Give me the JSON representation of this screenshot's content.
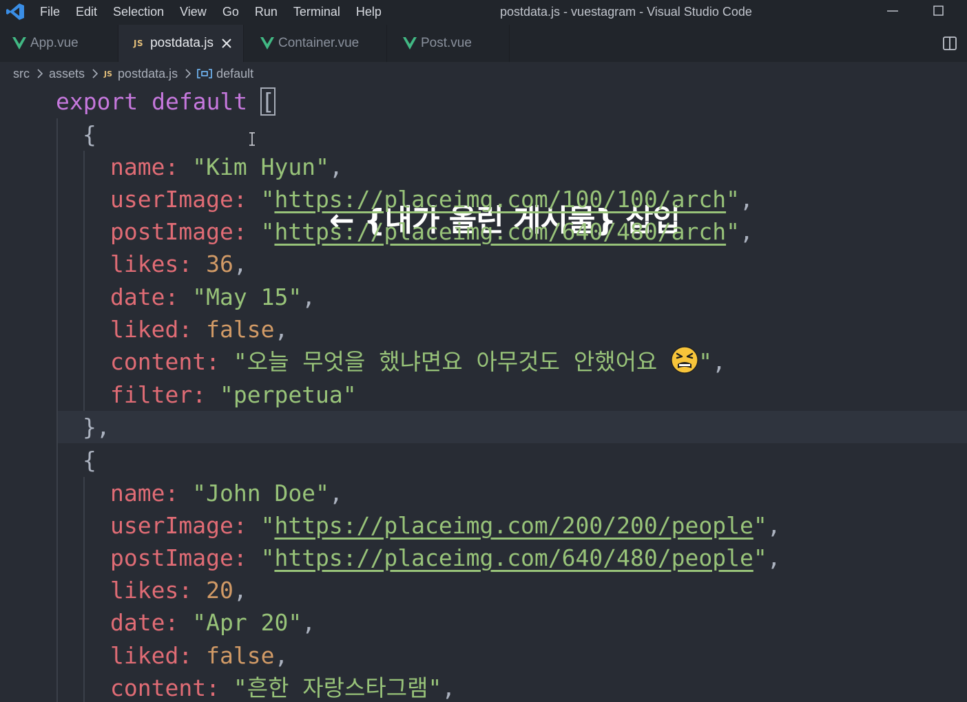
{
  "window": {
    "title": "postdata.js - vuestagram - Visual Studio Code",
    "menu": [
      "File",
      "Edit",
      "Selection",
      "View",
      "Go",
      "Run",
      "Terminal",
      "Help"
    ]
  },
  "tabs": [
    {
      "label": "App.vue",
      "icon": "vue-icon",
      "active": false
    },
    {
      "label": "postdata.js",
      "icon": "js-icon",
      "icon_text": "JS",
      "active": true
    },
    {
      "label": "Container.vue",
      "icon": "vue-icon",
      "active": false
    },
    {
      "label": "Post.vue",
      "icon": "vue-icon",
      "active": false
    }
  ],
  "breadcrumb": {
    "items": [
      "src",
      "assets",
      "postdata.js",
      "default"
    ],
    "js_icon_text": "JS"
  },
  "annotation": "← {내가 올린 게시물} 삽입",
  "code": {
    "export_kw": "export",
    "default_kw": "default",
    "open_bracket": "[",
    "posts": [
      {
        "name": "Kim Hyun",
        "userImage": "https://placeimg.com/100/100/arch",
        "postImage": "https://placeimg.com/640/480/arch",
        "likes": "36",
        "date": "May 15",
        "liked": "false",
        "content": "오늘 무엇을 했냐면요 아무것도 안했어요 ",
        "content_emoji": "tired-face-emoji",
        "filter": "perpetua"
      },
      {
        "name": "John Doe",
        "userImage": "https://placeimg.com/200/200/people",
        "postImage": "https://placeimg.com/640/480/people",
        "likes": "20",
        "date": "Apr 20",
        "liked": "false",
        "content": "흔한 자랑스타그램"
      }
    ],
    "keys": {
      "name": "name",
      "userImage": "userImage",
      "postImage": "postImage",
      "likes": "likes",
      "date": "date",
      "liked": "liked",
      "content": "content",
      "filter": "filter"
    }
  },
  "colors": {
    "keyword": "#c678dd",
    "property": "#e06c75",
    "string": "#98c379",
    "number": "#d19a66",
    "background": "#282c34"
  }
}
